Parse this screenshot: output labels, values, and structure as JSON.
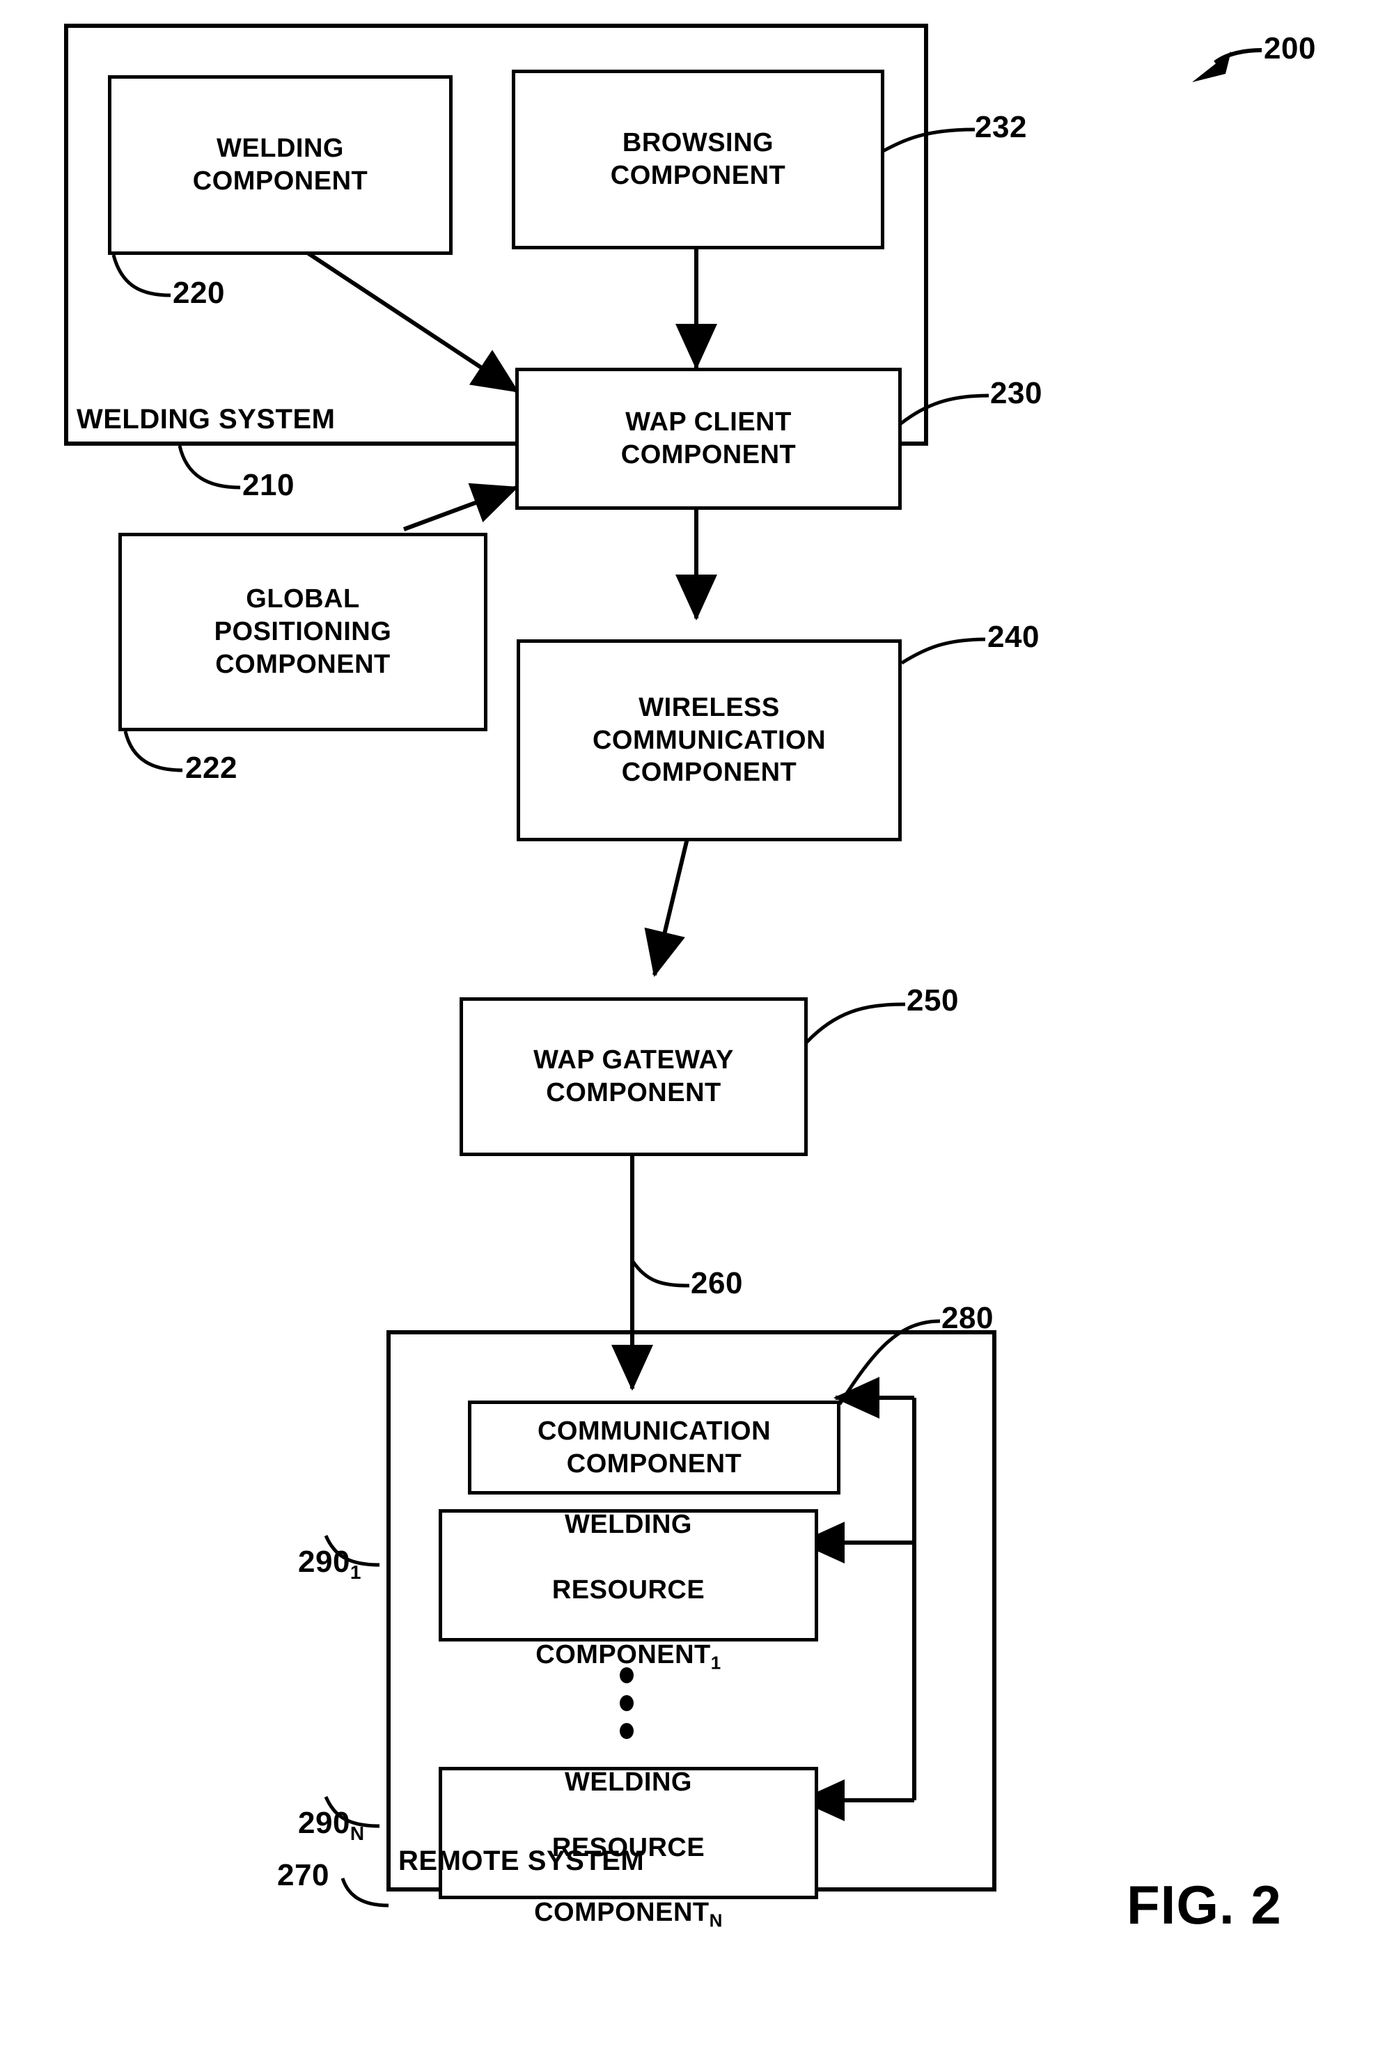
{
  "figure": {
    "caption": "FIG. 2",
    "overall_reference": "200"
  },
  "systems": [
    {
      "id": "welding-system",
      "label": "WELDING SYSTEM",
      "reference": "210"
    },
    {
      "id": "remote-system",
      "label": "REMOTE SYSTEM",
      "reference": "270"
    }
  ],
  "nodes": [
    {
      "id": "welding-component",
      "label": "WELDING\nCOMPONENT",
      "reference": "220"
    },
    {
      "id": "browsing-component",
      "label": "BROWSING\nCOMPONENT",
      "reference": "232"
    },
    {
      "id": "wap-client-component",
      "label": "WAP CLIENT\nCOMPONENT",
      "reference": "230"
    },
    {
      "id": "global-positioning-component",
      "label": "GLOBAL\nPOSITIONING\nCOMPONENT",
      "reference": "222"
    },
    {
      "id": "wireless-communication-component",
      "label": "WIRELESS\nCOMMUNICATION\nCOMPONENT",
      "reference": "240"
    },
    {
      "id": "wap-gateway-component",
      "label": "WAP GATEWAY\nCOMPONENT",
      "reference": "250"
    },
    {
      "id": "communication-component",
      "label": "COMMUNICATION\nCOMPONENT",
      "reference": "280"
    },
    {
      "id": "welding-resource-component-1",
      "label_line1": "WELDING",
      "label_line2": "RESOURCE",
      "label_line3": "COMPONENT",
      "subscript": "1",
      "reference": "290",
      "reference_subscript": "1"
    },
    {
      "id": "welding-resource-component-n",
      "label_line1": "WELDING",
      "label_line2": "RESOURCE",
      "label_line3": "COMPONENT",
      "subscript": "N",
      "reference": "290",
      "reference_subscript": "N"
    }
  ],
  "connections": [
    {
      "id": "link-gateway-wireless",
      "reference": "260"
    }
  ],
  "colors": {
    "line": "#000000",
    "background": "#ffffff",
    "text": "#000000"
  }
}
